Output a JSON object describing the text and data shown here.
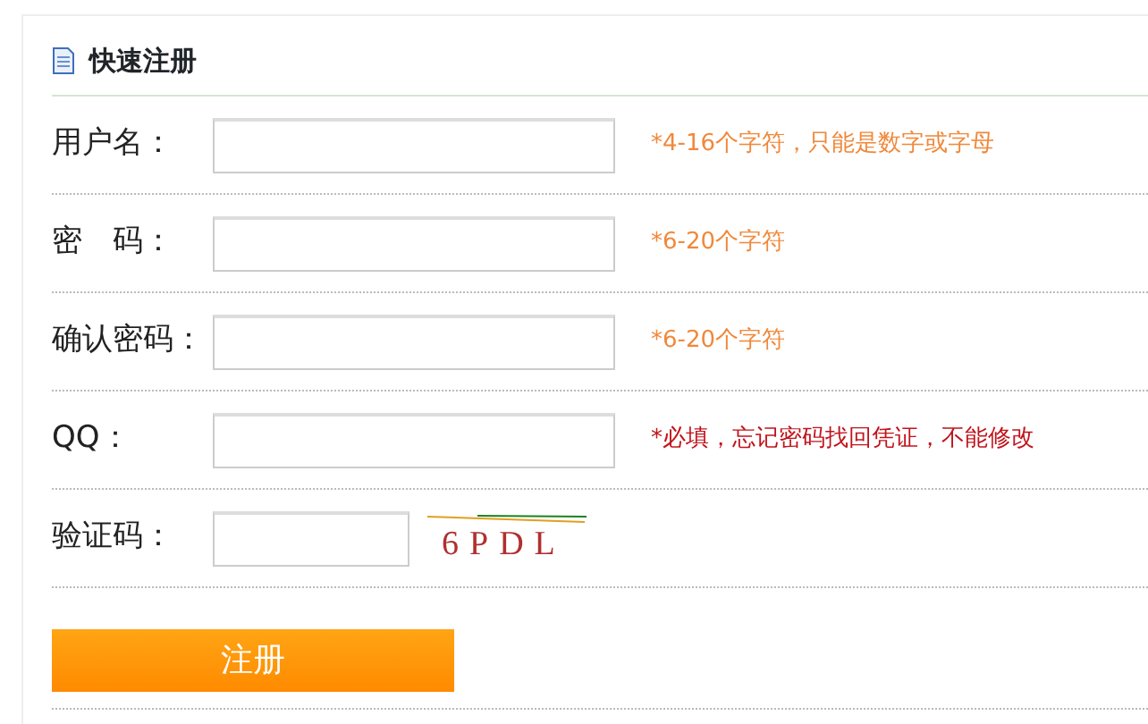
{
  "panel": {
    "title": "快速注册"
  },
  "fields": [
    {
      "kind": "text",
      "label": "用户名：",
      "hint": "*4-16个字符，只能是数字或字母",
      "color": "#f0883a"
    },
    {
      "kind": "text",
      "label": "密　码：",
      "hint": "*6-20个字符",
      "color": "#f0883a"
    },
    {
      "kind": "text",
      "label": "确认密码：",
      "hint": "*6-20个字符",
      "color": "#f0883a"
    },
    {
      "kind": "text",
      "label": "QQ：",
      "hint": "*必填，忘记密码找回凭证，不能修改",
      "color": "#c0141c"
    },
    {
      "kind": "captcha",
      "label": "验证码：",
      "code": "6PDL"
    }
  ],
  "submit": {
    "label": "注册"
  }
}
